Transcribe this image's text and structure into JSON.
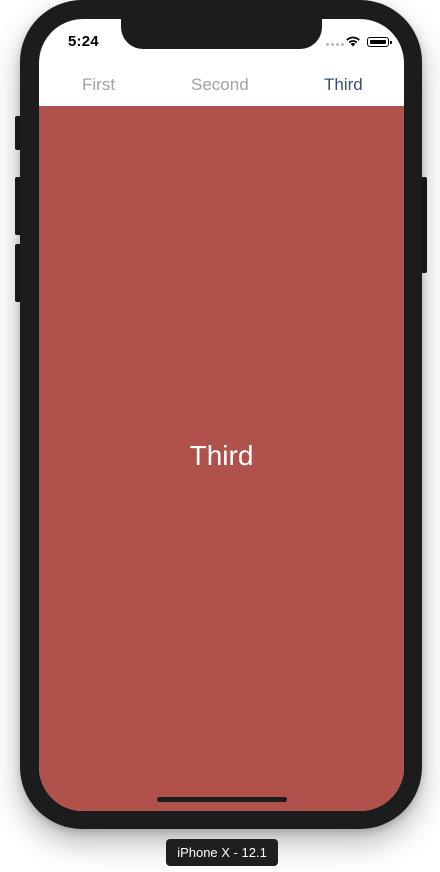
{
  "status_bar": {
    "time": "5:24"
  },
  "tabs": [
    {
      "label": "First",
      "selected": false
    },
    {
      "label": "Second",
      "selected": false
    },
    {
      "label": "Third",
      "selected": true
    }
  ],
  "content": {
    "title": "Third",
    "background_color": "#b0524b"
  },
  "device_label": "iPhone X - 12.1",
  "colors": {
    "tab_selected": "#3a4f7a",
    "tab_unselected": "#a2a2a8",
    "device_frame": "#1d1c1d"
  }
}
